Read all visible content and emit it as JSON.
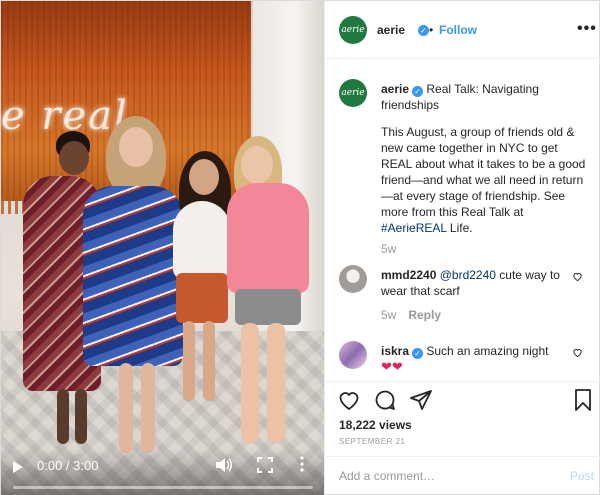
{
  "media": {
    "neon_text": "e real",
    "video": {
      "time_display": "0:00 / 3:00",
      "progress": 0.0
    }
  },
  "header": {
    "username": "aerie",
    "avatar_text": "aerie",
    "dot": "•",
    "follow_label": "Follow",
    "more_label": "•••"
  },
  "caption": {
    "username": "aerie",
    "title": "Real Talk: Navigating friendships",
    "body_start": "This August, a group of friends old & new came together in NYC to get REAL about what it takes to be a good friend—and what we all need in return—at every stage of friendship. See more from this Real Talk at ",
    "hashtag": "#AerieREAL",
    "body_end": " Life.",
    "time": "5w"
  },
  "comments": [
    {
      "username": "mmd2240",
      "mention": "@brd2240",
      "text": " cute way to wear that scarf",
      "time": "5w",
      "reply_label": "Reply"
    },
    {
      "username": "iskra",
      "verified": true,
      "text": "Such an amazing night",
      "emoji": "❤❤"
    }
  ],
  "stats": {
    "views": "18,222 views",
    "date": "SEPTEMBER 21"
  },
  "add_comment": {
    "placeholder": "Add a comment…",
    "post_label": "Post"
  },
  "colors": {
    "link": "#3897f0",
    "brand_green": "#1f7a3f",
    "muted": "#999999"
  }
}
